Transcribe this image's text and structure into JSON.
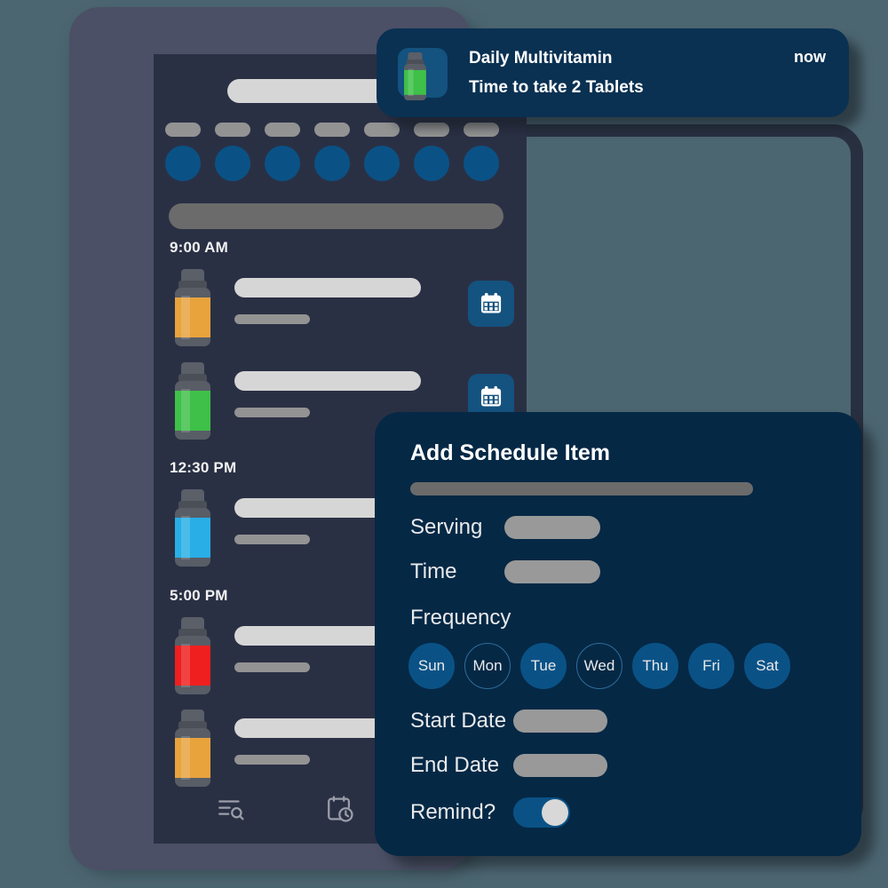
{
  "theme": {
    "page_bg": "#4c6671",
    "phone_frame": "#4b5066",
    "phone_screen": "#2a3044",
    "dialog_bg": "#052845",
    "notification_bg": "#0a3152",
    "accent_blue": "#0a5286",
    "icon_tile_blue": "#14527f",
    "placeholder_light": "#d6d6d6",
    "placeholder_mid": "#999999",
    "placeholder_dark": "#6b6b6b"
  },
  "notification": {
    "icon": "pill-bottle-icon",
    "title": "Daily Multivitamin",
    "subtitle": "Time to take 2 Tablets",
    "time": "now"
  },
  "phone": {
    "search_placeholder_bar": "",
    "week_strip": [
      {
        "label_placeholder": "",
        "dot": true
      },
      {
        "label_placeholder": "",
        "dot": true
      },
      {
        "label_placeholder": "",
        "dot": true
      },
      {
        "label_placeholder": "",
        "dot": true
      },
      {
        "label_placeholder": "",
        "dot": true
      },
      {
        "label_placeholder": "",
        "dot": true
      },
      {
        "label_placeholder": "",
        "dot": true
      }
    ],
    "schedule": [
      {
        "time": "9:00 AM",
        "items": [
          {
            "bottle_color": "#e8a33d",
            "has_calendar_button": true
          },
          {
            "bottle_color": "#3fc049",
            "has_calendar_button": true
          }
        ]
      },
      {
        "time": "12:30 PM",
        "items": [
          {
            "bottle_color": "#29aee6",
            "has_calendar_button": false
          }
        ]
      },
      {
        "time": "5:00 PM",
        "items": [
          {
            "bottle_color": "#f01f1f",
            "has_calendar_button": false
          },
          {
            "bottle_color": "#e8a33d",
            "has_calendar_button": false
          }
        ]
      }
    ],
    "bottom_nav": [
      {
        "icon": "list-search-icon"
      },
      {
        "icon": "calendar-clock-icon"
      },
      {
        "icon": "layers-icon"
      }
    ]
  },
  "dialog": {
    "title": "Add Schedule Item",
    "name_field_value": "",
    "fields": [
      {
        "label": "Serving",
        "value": "",
        "pill_width": 108
      },
      {
        "label": "Time",
        "value": "",
        "pill_width": 108
      }
    ],
    "frequency_label": "Frequency",
    "days": [
      {
        "label": "Sun",
        "selected": true
      },
      {
        "label": "Mon",
        "selected": false
      },
      {
        "label": "Tue",
        "selected": true
      },
      {
        "label": "Wed",
        "selected": false
      },
      {
        "label": "Thu",
        "selected": true
      },
      {
        "label": "Fri",
        "selected": true
      },
      {
        "label": "Sat",
        "selected": true
      }
    ],
    "date_fields": [
      {
        "label": "Start Date",
        "value": "",
        "pill_width": 106
      },
      {
        "label": "End Date",
        "value": "",
        "pill_width": 106
      }
    ],
    "remind": {
      "label": "Remind?",
      "enabled": true
    }
  }
}
